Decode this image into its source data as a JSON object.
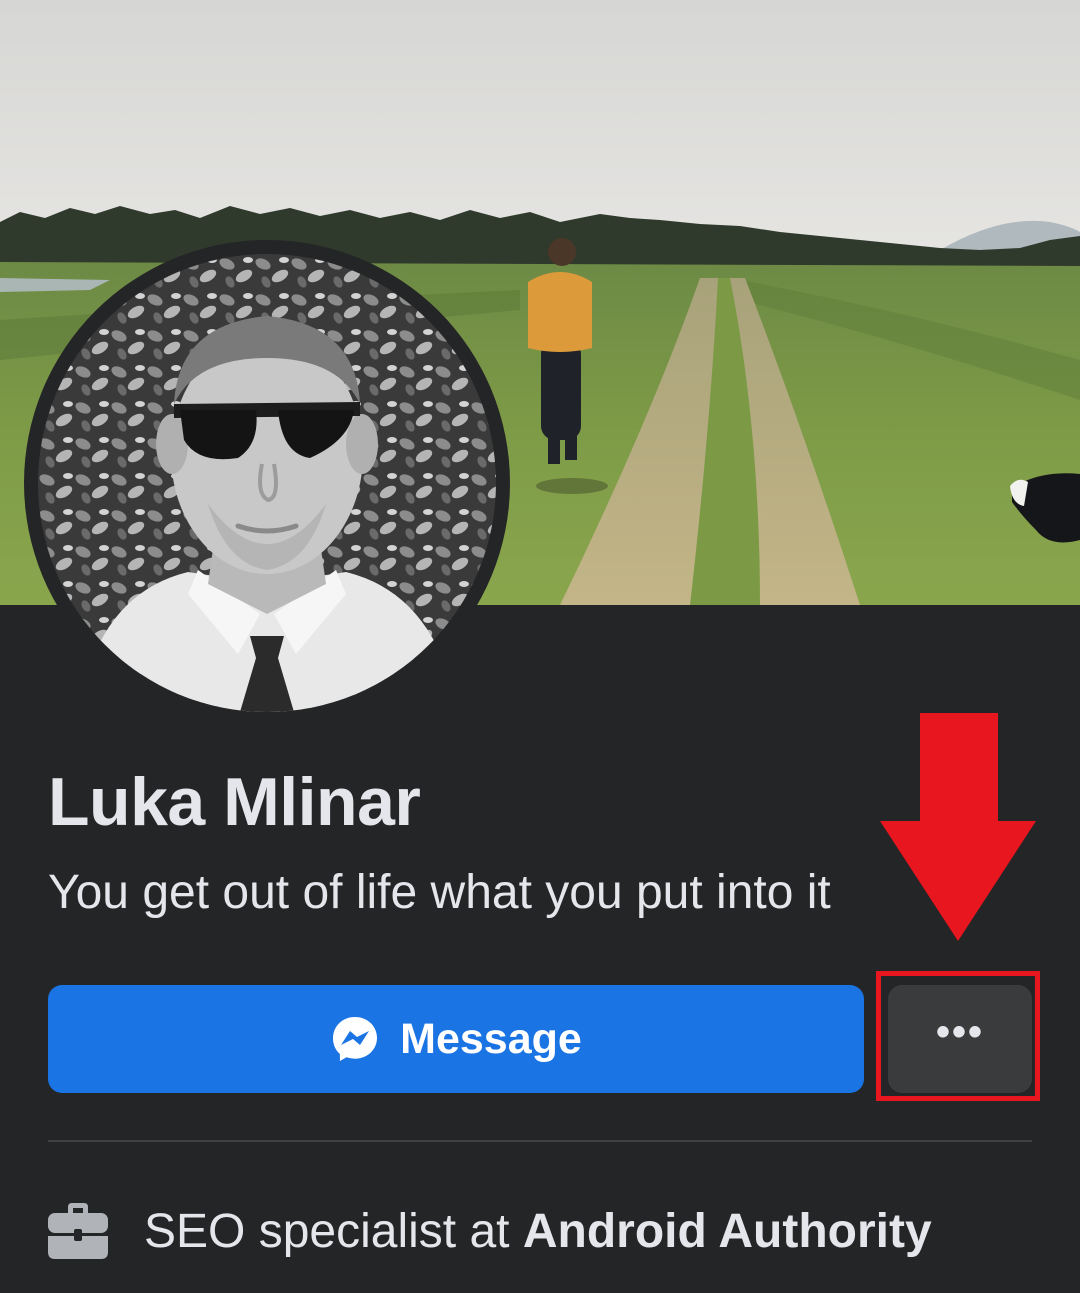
{
  "profile": {
    "name": "Luka Mlinar",
    "bio": "You get out of life what you put into it"
  },
  "actions": {
    "message_label": "Message",
    "message_icon": "messenger-icon",
    "more_label": "•••",
    "more_icon": "more-options-icon"
  },
  "work": {
    "icon": "briefcase-icon",
    "prefix": "SEO specialist at ",
    "company": "Android Authority"
  },
  "colors": {
    "background": "#242526",
    "primary_button": "#1b74e4",
    "secondary_button": "#3a3b3c",
    "text": "#e4e6eb",
    "annotation": "#e8161f"
  }
}
